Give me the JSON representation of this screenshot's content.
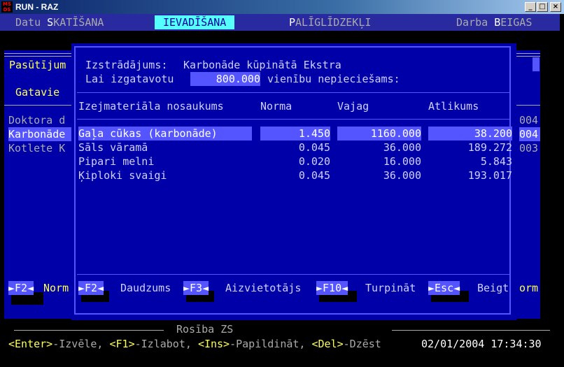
{
  "window": {
    "title": "RUN - RAZ",
    "icon_text": "MS\nDS",
    "minimize": "_",
    "maximize": "□",
    "close": "×"
  },
  "menu": [
    {
      "pre": "Datu ",
      "hot": "S",
      "post": "KATĪŠANA"
    },
    {
      "pre": "",
      "hot": "I",
      "post": "EVADĪŠANA"
    },
    {
      "pre": "",
      "hot": "P",
      "post": "ALĪGLĪDZEKĻI"
    },
    {
      "pre": "Darba ",
      "hot": "B",
      "post": "EIGAS"
    }
  ],
  "background": {
    "left_label_1": "Pasūtījum",
    "left_label_2": "Gatavie",
    "rows": [
      "Doktora d",
      "Karbonāde",
      "Kotlete K"
    ],
    "right_codes": [
      "004",
      "004",
      "003"
    ],
    "bottom_fkey": "F2",
    "bottom_fkey_label": "Norm",
    "bottom_right_label": "orm",
    "section_label": "Rosība ZS"
  },
  "dialog": {
    "product_label": "Izstrādājums:",
    "product_name": "Karbonāde kūpinātā Ekstra",
    "qty_label": "Lai izgatavotu",
    "qty_value": "800.000",
    "qty_suffix": "vienību nepieciešams:",
    "columns": [
      "Izejmateriāla nosaukums",
      "Norma",
      "Vajag",
      "Atlikums"
    ],
    "rows": [
      {
        "name": "Gaļa cūkas (karbonāde)",
        "norma": "1.450",
        "vajag": "1160.000",
        "atlikums": "38.200"
      },
      {
        "name": "Sāls vāramā",
        "norma": "0.045",
        "vajag": "36.000",
        "atlikums": "189.272"
      },
      {
        "name": "Pipari melni",
        "norma": "0.020",
        "vajag": "16.000",
        "atlikums": "5.843"
      },
      {
        "name": "Ķiploki svaigi",
        "norma": "0.045",
        "vajag": "36.000",
        "atlikums": "193.017"
      }
    ],
    "fkeys": [
      {
        "key": "F2",
        "label": "Daudzums"
      },
      {
        "key": "F3",
        "label": "Aizvietotājs"
      },
      {
        "key": "F10",
        "label": "Turpināt"
      },
      {
        "key": "Esc",
        "label": "Beigt"
      }
    ]
  },
  "status": {
    "hints": [
      {
        "key": "<Enter>",
        "text": "-Izvēle, "
      },
      {
        "key": "<F1>",
        "text": "-Izlabot, "
      },
      {
        "key": "<Ins>",
        "text": "-Papildināt, "
      },
      {
        "key": "<Del>",
        "text": "-Dzēst"
      }
    ],
    "datetime": "02/01/2004 17:34:30"
  },
  "colors": {
    "console_bg": "#000000",
    "panel_blue": "#0000a8",
    "highlight": "#5555ff",
    "menu_active": "#55ffff",
    "hotkey_yellow": "#ffff55"
  }
}
